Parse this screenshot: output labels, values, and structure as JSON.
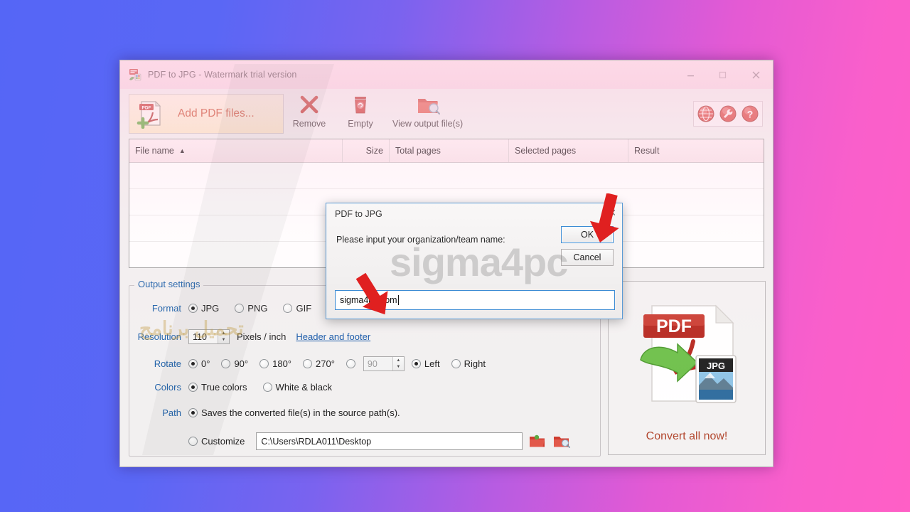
{
  "window": {
    "title": "PDF to JPG - Watermark trial version",
    "app_icon": "pdf-to-jpg-app-icon",
    "minimize_label": "–",
    "maximize_label": "□",
    "close_label": "✕"
  },
  "toolbar": {
    "add_files_label": "Add PDF files...",
    "add_files_icon": "add-pdf-file-icon",
    "buttons": [
      {
        "label": "Remove",
        "icon": "red-x-icon"
      },
      {
        "label": "Empty",
        "icon": "trash-bin-icon"
      },
      {
        "label": "View output file(s)",
        "icon": "folder-search-icon"
      }
    ],
    "round_buttons": [
      {
        "name": "globe-button",
        "icon": "globe-icon"
      },
      {
        "name": "tools-button",
        "icon": "wrench-icon"
      },
      {
        "name": "help-button",
        "icon": "question-mark-icon"
      }
    ]
  },
  "file_list": {
    "columns": [
      {
        "label": "File name",
        "sorted": true,
        "sort_arrow": "▲"
      },
      {
        "label": "Size"
      },
      {
        "label": "Total pages"
      },
      {
        "label": "Selected pages"
      },
      {
        "label": "Result"
      }
    ],
    "rows": []
  },
  "output_settings": {
    "legend": "Output settings",
    "format": {
      "label": "Format",
      "options": [
        "JPG",
        "PNG",
        "GIF"
      ],
      "selected": "JPG"
    },
    "resolution": {
      "label": "Resolution",
      "value": "110",
      "unit": "Pixels / inch",
      "link": "Header and footer"
    },
    "rotate": {
      "label": "Rotate",
      "options": [
        "0°",
        "90°",
        "180°",
        "270°"
      ],
      "selected": "0°",
      "custom_value": "90",
      "direction_options": [
        "Left",
        "Right"
      ],
      "direction_selected": "Left"
    },
    "colors": {
      "label": "Colors",
      "options": [
        "True colors",
        "White & black"
      ],
      "selected": "True colors"
    },
    "path": {
      "label": "Path",
      "source_option": "Saves the converted file(s) in the source path(s).",
      "customize_option": "Customize",
      "selected": "source",
      "customize_path": "C:\\Users\\RDLA011\\Desktop",
      "browse_icon": "open-folder-icon",
      "view_icon": "folder-search-icon"
    }
  },
  "convert_panel": {
    "label": "Convert all now!",
    "from_format": "PDF",
    "to_format": "JPG",
    "icon": "pdf-to-jpg-convert-icon"
  },
  "modal": {
    "title": "PDF to JPG",
    "close_label": "✕",
    "prompt": "Please input your organization/team name:",
    "ok_label": "OK",
    "cancel_label": "Cancel",
    "input_value": "sigma4pc.com",
    "input_placeholder": ""
  },
  "watermarks": {
    "site": "sigma4pc",
    "arabic": "تحميل برنامج"
  },
  "annotations": [
    {
      "name": "arrow-pointing-to-ok-button",
      "color": "#e02020"
    },
    {
      "name": "arrow-pointing-to-name-input",
      "color": "#e02020"
    }
  ],
  "colors": {
    "accent_blue": "#1b5fa8",
    "brand_red": "#c94a2a",
    "arrow_red": "#e02020",
    "focus_blue": "#3c8cd4"
  }
}
